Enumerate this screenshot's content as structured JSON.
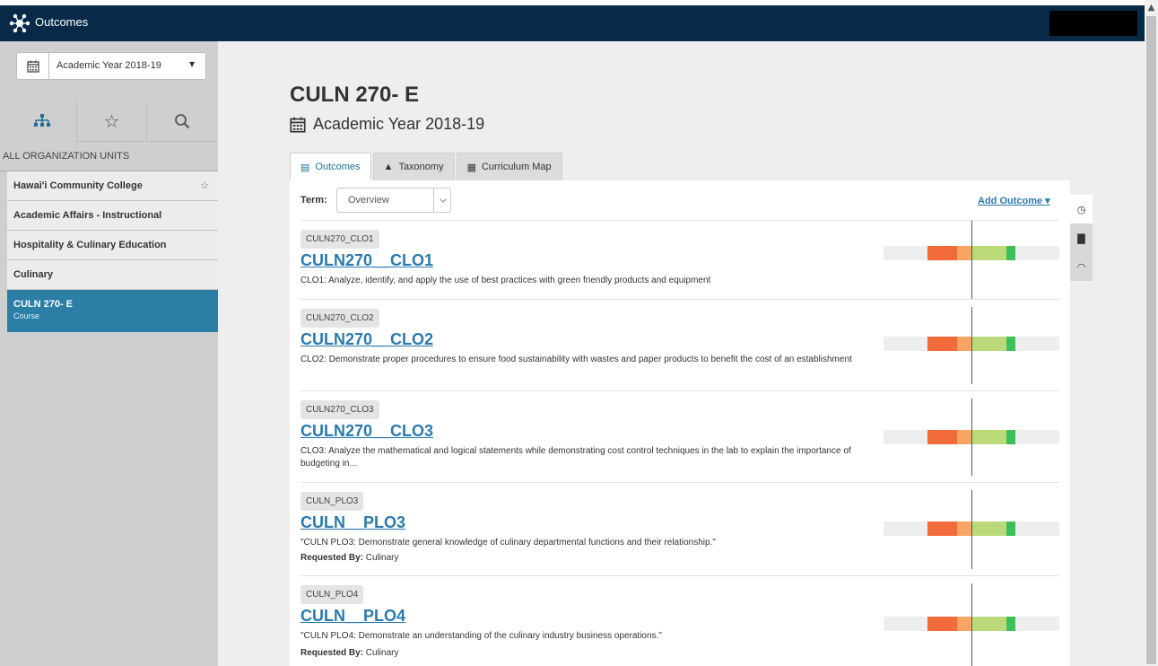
{
  "app": {
    "title": "Outcomes",
    "logo_icon": "network-logo-icon"
  },
  "sidebar": {
    "year_button": {
      "label": "Academic Year 2018-19",
      "icon": "calendar-icon"
    },
    "tabs": [
      {
        "icon": "org-tree-icon",
        "glyph": "∷",
        "active": true
      },
      {
        "icon": "star-icon",
        "glyph": "☆",
        "active": false
      },
      {
        "icon": "search-icon",
        "glyph": "⌕",
        "active": false
      }
    ],
    "section_label": "ALL ORGANIZATION UNITS",
    "units": [
      {
        "label": "Hawai'i Community College",
        "starred_icon": "☆"
      },
      {
        "label": "Academic Affairs - Instructional"
      },
      {
        "label": "Hospitality & Culinary Education"
      },
      {
        "label": "Culinary"
      }
    ],
    "current_unit": {
      "label": "CULN 270- E",
      "type": "Course"
    }
  },
  "main": {
    "title": "CULN 270- E",
    "subtitle": "Academic Year 2018-19",
    "tabs": [
      {
        "label": "Outcomes",
        "icon": "list-icon",
        "glyph": "▤",
        "active": true
      },
      {
        "label": "Taxonomy",
        "icon": "pyramid-icon",
        "glyph": "▲",
        "active": false
      },
      {
        "label": "Curriculum Map",
        "icon": "grid-icon",
        "glyph": "▦",
        "active": false
      }
    ],
    "term_label": "Term:",
    "term_value": "Overview",
    "add_outcome_label": "Add Outcome ▾",
    "side_tools": [
      {
        "icon": "clock-icon",
        "glyph": "◷"
      },
      {
        "icon": "bar-chart-icon",
        "glyph": "▇"
      },
      {
        "icon": "gauge-icon",
        "glyph": "◠"
      }
    ],
    "outcomes": [
      {
        "tag": "CULN270_CLO1",
        "title": "CULN270__CLO1",
        "desc": "CLO1: Analyze, identify, and apply the use of best practices with green friendly products and equipment",
        "requested_by_label": "",
        "requested_by": ""
      },
      {
        "tag": "CULN270_CLO2",
        "title": "CULN270__CLO2",
        "desc": "CLO2: Demonstrate proper procedures to ensure food sustainability with wastes and paper products to benefit the cost of an establishment",
        "requested_by_label": "",
        "requested_by": ""
      },
      {
        "tag": "CULN270_CLO3",
        "title": "CULN270__CLO3",
        "desc": "CLO3: Analyze the mathematical and logical statements while demonstrating cost control techniques in the lab to explain the importance of budgeting in...",
        "requested_by_label": "",
        "requested_by": ""
      },
      {
        "tag": "CULN_PLO3",
        "title": "CULN__PLO3",
        "desc": "\"CULN PLO3: Demonstrate general knowledge of culinary departmental functions and their relationship.\"",
        "requested_by_label": "Requested By:",
        "requested_by": "Culinary"
      },
      {
        "tag": "CULN_PLO4",
        "title": "CULN__PLO4",
        "desc": "\"CULN PLO4: Demonstrate an understanding of the culinary industry business operations.\"",
        "requested_by_label": "Requested By:",
        "requested_by": "Culinary"
      }
    ],
    "performance_bar": {
      "segments": [
        {
          "name": "empty",
          "from": 0.0,
          "to": 0.25,
          "color": "#eeeeee"
        },
        {
          "name": "red",
          "from": 0.25,
          "to": 0.42,
          "color": "#f26b3a"
        },
        {
          "name": "orange",
          "from": 0.42,
          "to": 0.5,
          "color": "#f7a563"
        },
        {
          "name": "light-green",
          "from": 0.5,
          "to": 0.7,
          "color": "#bcd97a"
        },
        {
          "name": "green",
          "from": 0.7,
          "to": 0.75,
          "color": "#3fbf5a"
        },
        {
          "name": "empty-right",
          "from": 0.75,
          "to": 1.0,
          "color": "#eeeeee"
        }
      ],
      "marker": 0.5
    }
  }
}
